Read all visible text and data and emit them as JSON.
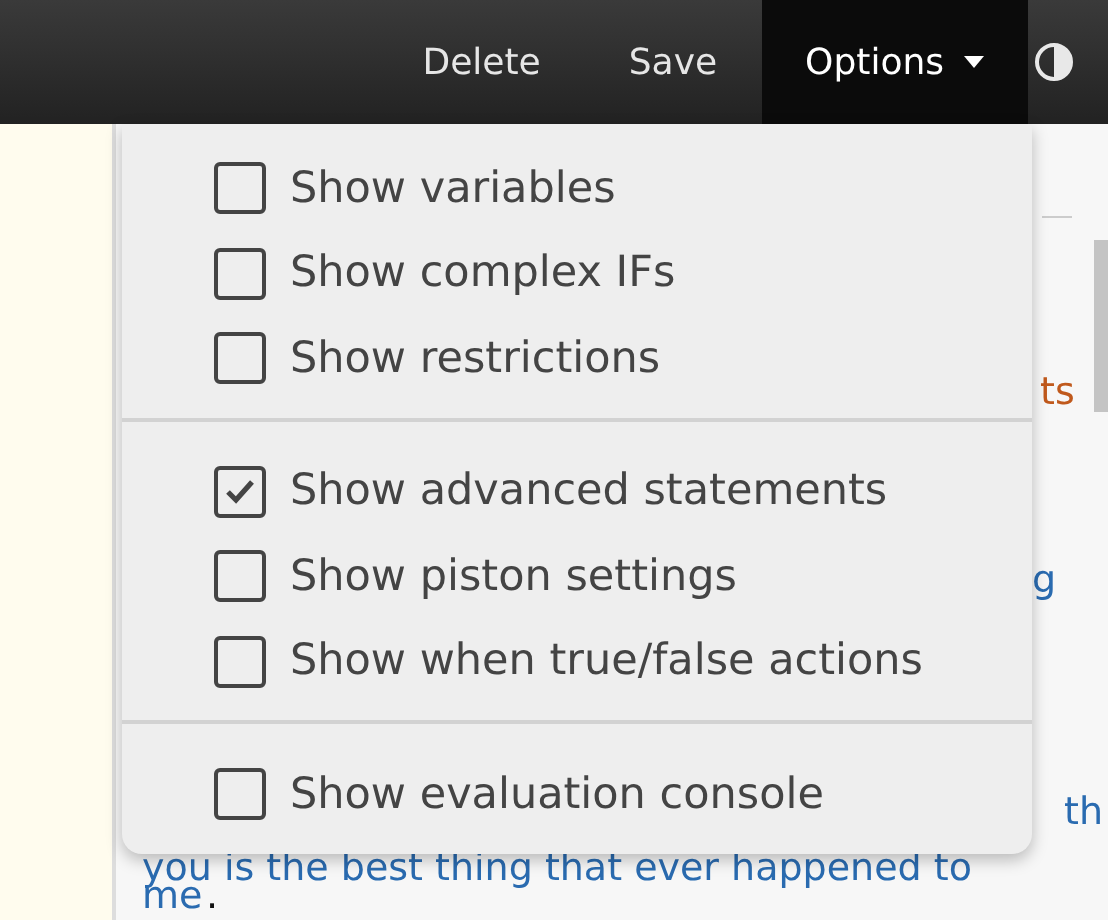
{
  "toolbar": {
    "buttons": [
      {
        "label": "Delete",
        "selected": false
      },
      {
        "label": "Save",
        "selected": false
      },
      {
        "label": "Options",
        "selected": true
      }
    ]
  },
  "options_menu": {
    "sections": [
      {
        "items": [
          {
            "label": "Show variables",
            "checked": false
          },
          {
            "label": "Show complex IFs",
            "checked": false
          },
          {
            "label": "Show restrictions",
            "checked": false
          }
        ]
      },
      {
        "items": [
          {
            "label": "Show advanced statements",
            "checked": true
          },
          {
            "label": "Show piston settings",
            "checked": false
          },
          {
            "label": "Show when true/false actions",
            "checked": false
          }
        ]
      },
      {
        "items": [
          {
            "label": "Show evaluation console",
            "checked": false
          }
        ]
      }
    ]
  },
  "background_text": [
    {
      "text": "ts",
      "kind": "keyword"
    },
    {
      "text": "g",
      "kind": "link"
    },
    {
      "text": "th",
      "kind": "link"
    },
    {
      "text": "you is the best thing that ever happened to",
      "kind": "link"
    },
    {
      "text": "me",
      "kind": "link"
    },
    {
      "text": ".",
      "kind": "plain"
    }
  ]
}
